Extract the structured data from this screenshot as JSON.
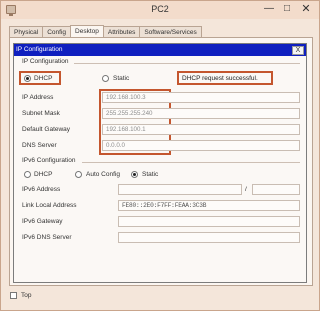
{
  "window": {
    "title": "PC2",
    "minimize": "—",
    "maximize": "□",
    "close": "✕"
  },
  "tabs": [
    {
      "label": "Physical"
    },
    {
      "label": "Config"
    },
    {
      "label": "Desktop"
    },
    {
      "label": "Attributes"
    },
    {
      "label": "Software/Services"
    }
  ],
  "active_tab": "Desktop",
  "dialog": {
    "title": "IP Configuration",
    "close": "X",
    "ipv4": {
      "section_title": "IP Configuration",
      "dhcp_label": "DHCP",
      "static_label": "Static",
      "mode": "DHCP",
      "status": "DHCP request successful.",
      "ip_address_label": "IP Address",
      "ip_address": "192.168.100.3",
      "subnet_mask_label": "Subnet Mask",
      "subnet_mask": "255.255.255.240",
      "default_gateway_label": "Default Gateway",
      "default_gateway": "192.168.100.1",
      "dns_server_label": "DNS Server",
      "dns_server": "0.0.0.0"
    },
    "ipv6": {
      "section_title": "IPv6 Configuration",
      "dhcp_label": "DHCP",
      "auto_config_label": "Auto Config",
      "static_label": "Static",
      "mode": "Static",
      "ipv6_address_label": "IPv6 Address",
      "ipv6_address": "",
      "prefix_separator": "/",
      "prefix_length": "",
      "link_local_label": "Link Local Address",
      "link_local": "FE80::2E0:F7FF:FEAA:3C3B",
      "ipv6_gateway_label": "IPv6 Gateway",
      "ipv6_gateway": "",
      "ipv6_dns_label": "IPv6 DNS Server",
      "ipv6_dns": ""
    }
  },
  "footer": {
    "top_label": "Top",
    "top_checked": false
  },
  "colors": {
    "dialog_header": "#0f1fbf",
    "highlight": "#c4562e",
    "window_bg": "#f4e6da"
  }
}
